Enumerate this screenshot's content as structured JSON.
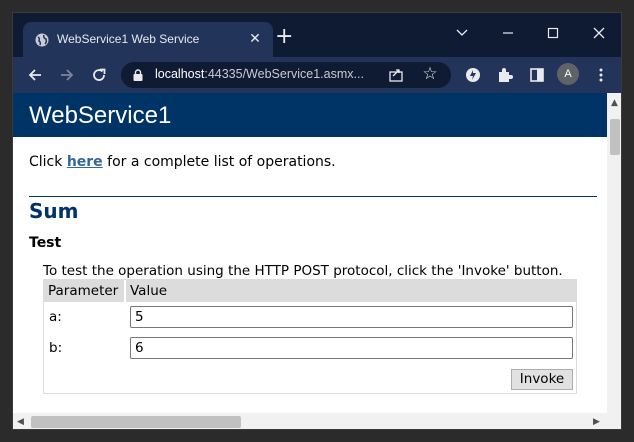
{
  "browser": {
    "tab_title": "WebService1 Web Service",
    "url_host": "localhost",
    "url_rest": ":44335/WebService1.asmx...",
    "avatar_letter": "A"
  },
  "page": {
    "title": "WebService1",
    "intro_prefix": "Click ",
    "intro_link": "here",
    "intro_suffix": " for a complete list of operations.",
    "operation": "Sum",
    "test_heading": "Test",
    "test_description": "To test the operation using the HTTP POST protocol, click the 'Invoke' button.",
    "table_headers": [
      "Parameter",
      "Value"
    ],
    "params": [
      {
        "label": "a:",
        "value": "5"
      },
      {
        "label": "b:",
        "value": "6"
      }
    ],
    "invoke_label": "Invoke"
  },
  "colors": {
    "header_bg": "#003366",
    "link": "#336699"
  }
}
